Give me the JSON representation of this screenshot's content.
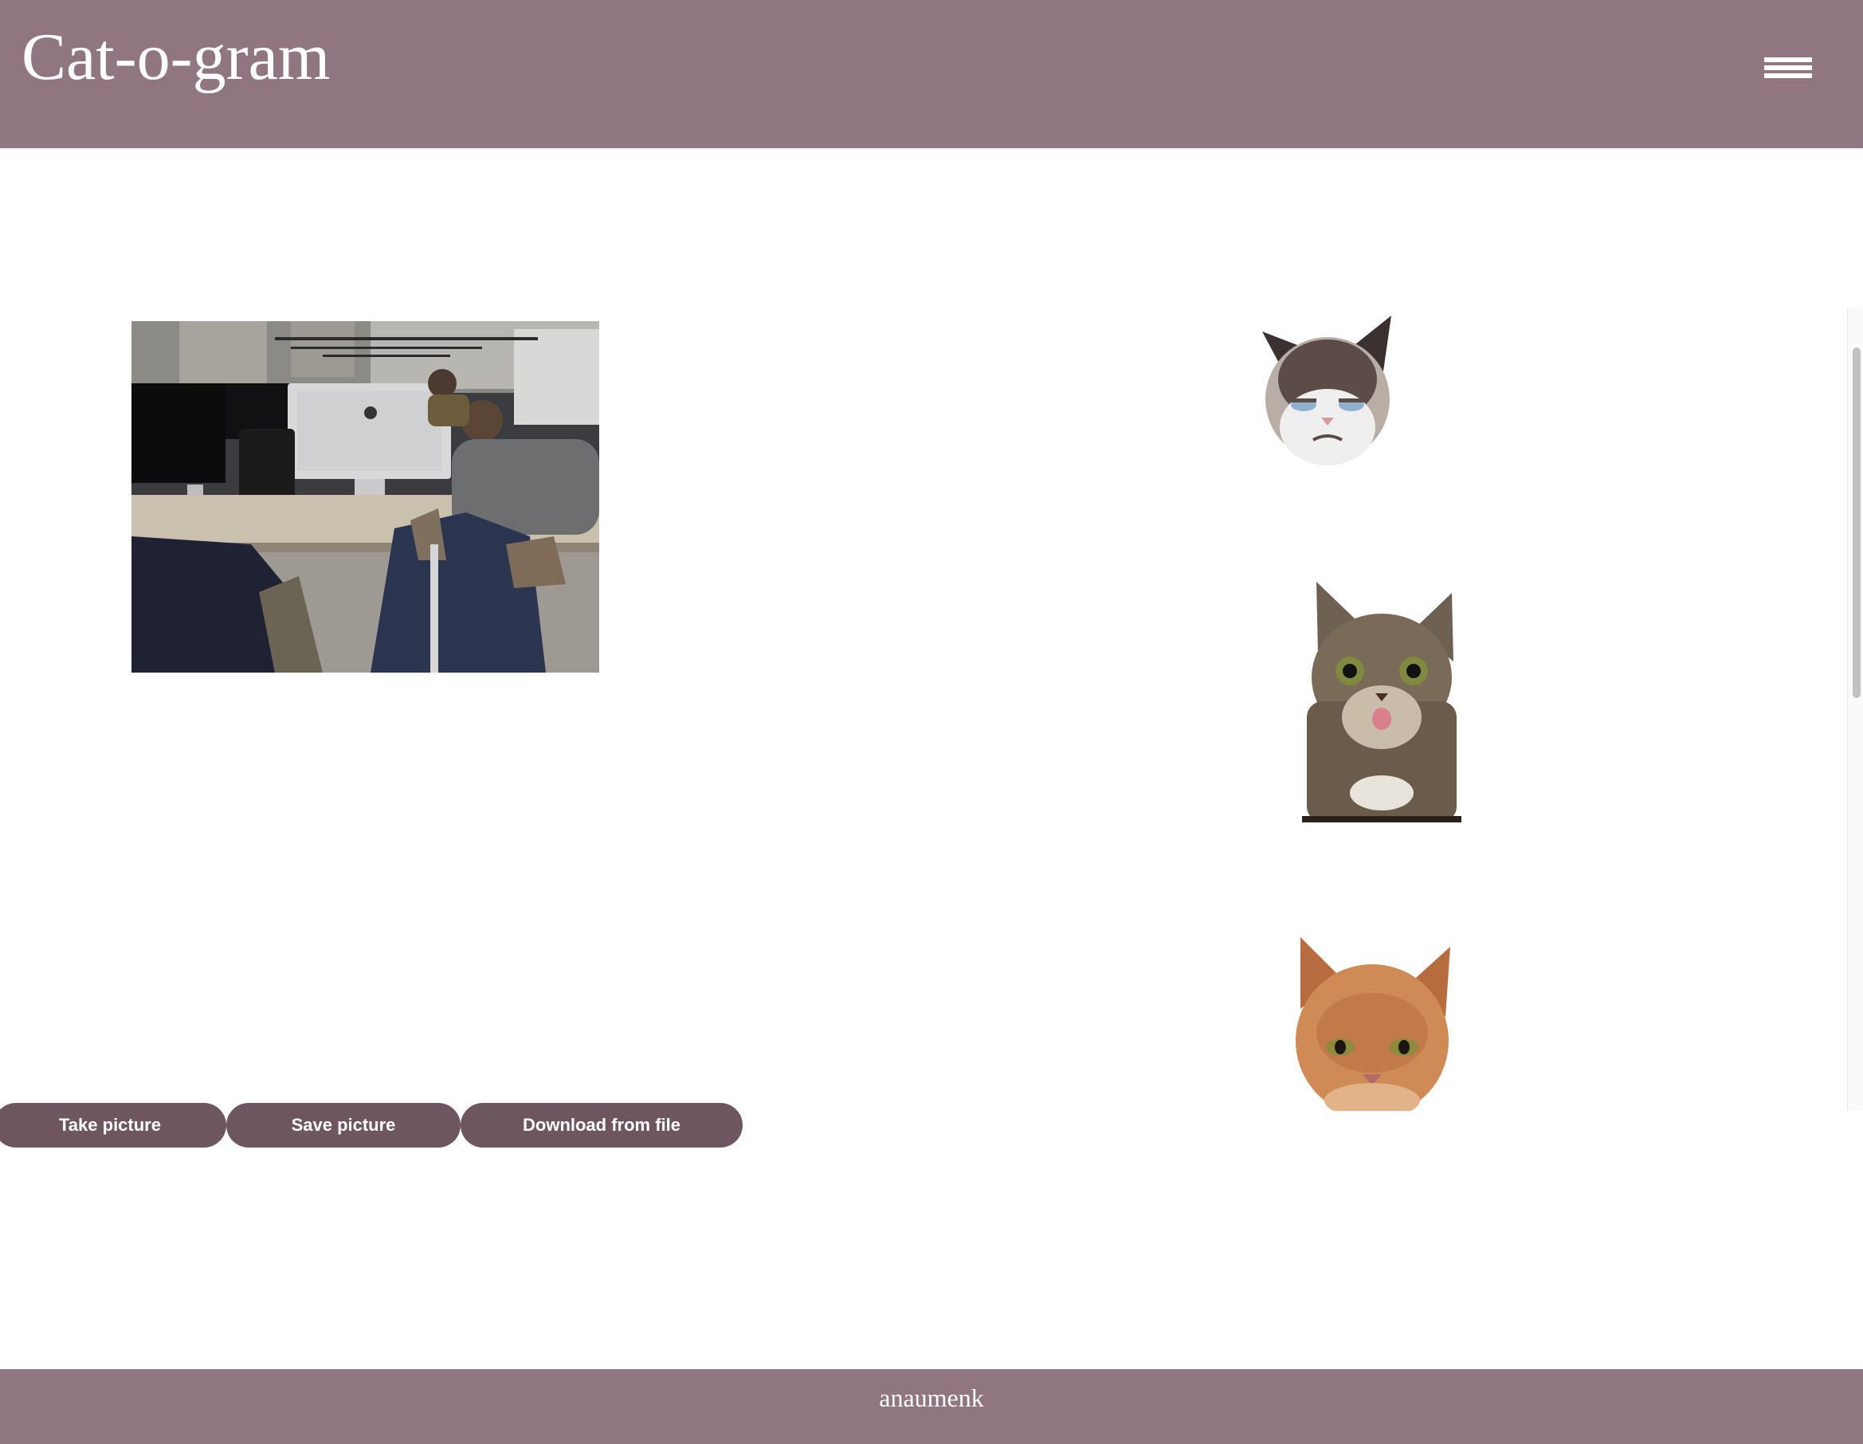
{
  "header": {
    "title": "Cat-o-gram",
    "menu_icon": "hamburger-menu-icon"
  },
  "camera": {
    "scene": "office-webcam-preview"
  },
  "buttons": {
    "take_picture": "Take picture",
    "save_picture": "Save picture",
    "download_from_file": "Download from file"
  },
  "stickers": [
    {
      "name": "grumpy-cat-sticker"
    },
    {
      "name": "lil-bub-cat-sticker"
    },
    {
      "name": "orange-tabby-cat-sticker"
    }
  ],
  "footer": {
    "author": "anaumenk"
  },
  "colors": {
    "header_bg": "#8f7680",
    "button_bg": "#6d5660",
    "text_light": "#ffffff"
  }
}
